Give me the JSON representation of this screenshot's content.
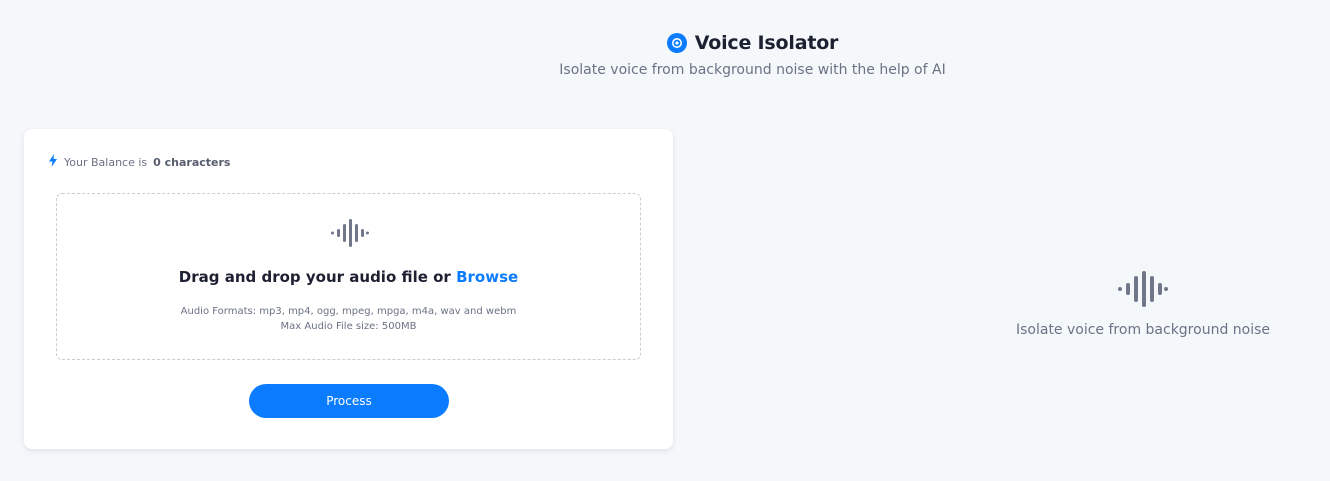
{
  "header": {
    "title": "Voice Isolator",
    "subtitle": "Isolate voice from background noise with the help of AI",
    "icon": "target-icon"
  },
  "balance": {
    "prefix": "Your Balance is",
    "value": "0 characters",
    "icon": "lightning-icon"
  },
  "dropzone": {
    "icon": "audio-wave-icon",
    "title": "Drag and drop your audio file or",
    "browse_label": "Browse",
    "formats": "Audio Formats: mp3, mp4, ogg, mpeg, mpga, m4a, wav and webm",
    "max_size": "Max Audio File size: 500MB"
  },
  "process_button": {
    "label": "Process"
  },
  "result_panel": {
    "icon": "audio-wave-icon",
    "text": "Isolate voice from background noise"
  },
  "colors": {
    "accent": "#0b7bff",
    "background": "#f5f8fb",
    "text_muted": "#6b7285",
    "icon_gray": "#6f7789"
  }
}
